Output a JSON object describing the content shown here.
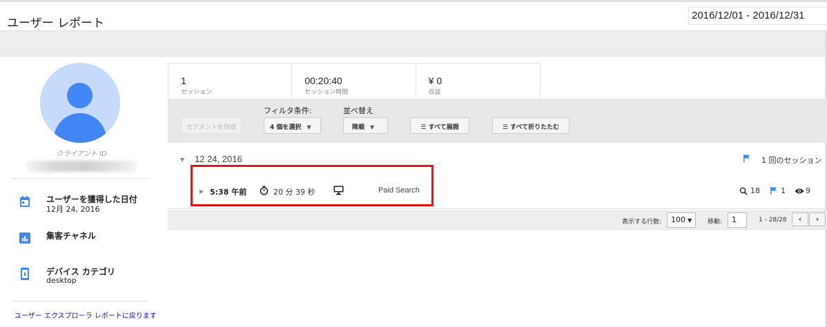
{
  "header": {
    "title": "ユーザー レポート",
    "date_range": "2016/12/01 - 2016/12/31"
  },
  "left_panel": {
    "client_id_label": "クライアント ID",
    "acquired_date_label": "ユーザーを獲得した日付",
    "acquired_date_value": "12月 24, 2016",
    "channel_label": "集客チャネル",
    "device_label": "デバイス カテゴリ",
    "device_value": "desktop",
    "back_link": "ユーザー エクスプローラ レポートに戻ります"
  },
  "metrics": [
    {
      "value": "1",
      "label": "セッション"
    },
    {
      "value": "00:20:40",
      "label": "セッション時間"
    },
    {
      "value": "¥ 0",
      "label": "収益"
    }
  ],
  "filters": {
    "create_segment": "セグメントを作成",
    "filter_label": "フィルタ条件:",
    "filter_value": "4 個を選択",
    "sort_label": "並べ替え",
    "sort_value": "降順",
    "expand_all": "すべて展開",
    "collapse_all": "すべて折りたたむ"
  },
  "date_group": {
    "date": "12 24, 2016",
    "session_count": "1 回のセッション"
  },
  "session": {
    "time": "5:38 午前",
    "duration": "20 分 39 秒",
    "source": "Paid Search",
    "searches": "18",
    "events": "1",
    "pageviews": "9"
  },
  "pagination": {
    "rows_label": "表示する行数:",
    "rows_value": "100",
    "goto_label": "移動:",
    "goto_value": "1",
    "range": "1 - 28/28"
  },
  "colors": {
    "accent": "#4285f4",
    "highlight": "#e3151a"
  }
}
